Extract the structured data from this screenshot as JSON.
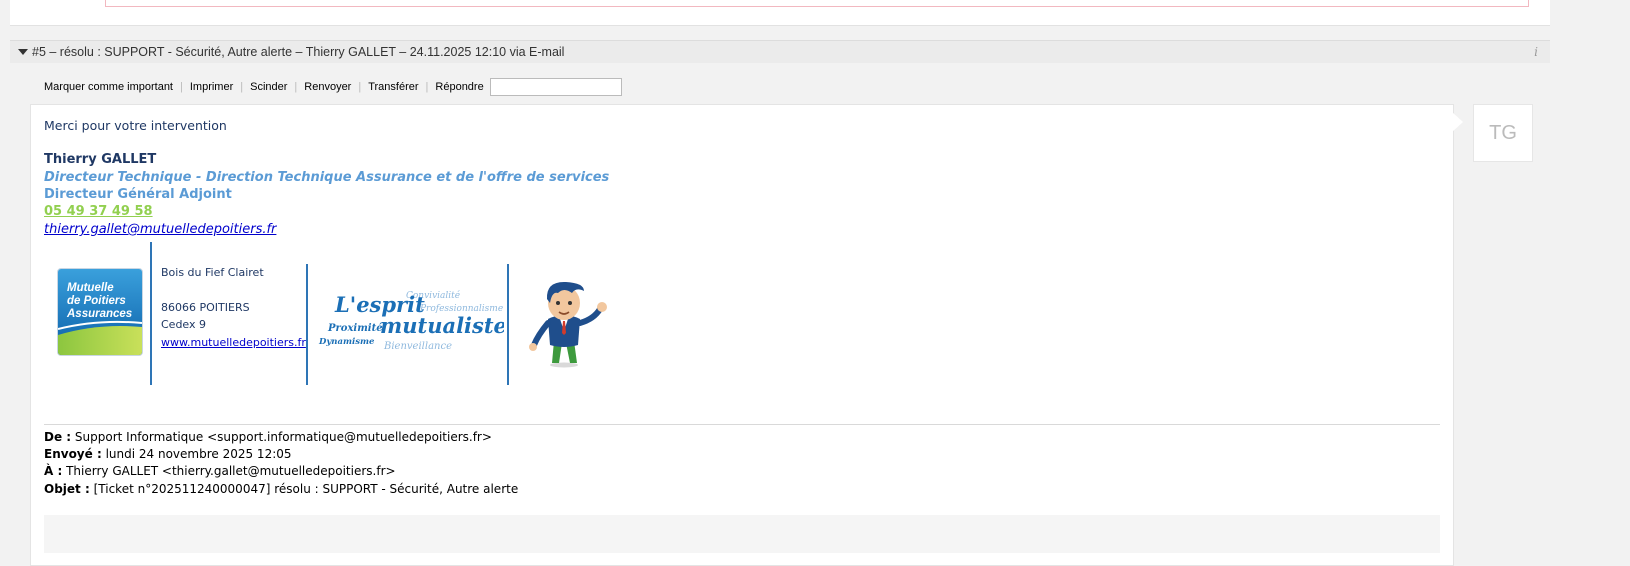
{
  "message": {
    "title": "#5 – résolu : SUPPORT - Sécurité, Autre alerte – Thierry GALLET – 24.11.2025 12:10 via E-mail"
  },
  "toolbar": {
    "important": "Marquer comme important",
    "print": "Imprimer",
    "split": "Scinder",
    "resend": "Renvoyer",
    "forward": "Transférer",
    "reply": "Répondre",
    "reply_value": ""
  },
  "avatar": {
    "initials": "TG"
  },
  "body": {
    "greeting": "Merci pour votre intervention",
    "signature": {
      "name": "Thierry GALLET",
      "role1": "Directeur Technique - Direction Technique Assurance et de l'offre de services",
      "role2": "Directeur Général Adjoint",
      "phone": "05 49 37 49 58",
      "email": "thierry.gallet@mutuelledepoitiers.fr"
    },
    "address": {
      "line1": "Bois du Fief Clairet",
      "line2": "86066 POITIERS",
      "line3": "Cedex 9",
      "website": "www.mutuelledepoitiers.fr"
    },
    "logo_text": [
      "Mutuelle",
      "de Poitiers",
      "Assurances"
    ],
    "slogan": {
      "esprit": "L'esprit",
      "mutualiste": "mutualiste",
      "words": [
        "Convivialité",
        "Professionnalisme",
        "Proximité",
        "Dynamisme",
        "Bienveillance"
      ]
    }
  },
  "quoted_header": {
    "from_label": "De :",
    "from": "Support Informatique <support.informatique@mutuelledepoitiers.fr>",
    "sent_label": "Envoyé :",
    "sent": "lundi 24 novembre 2025 12:05",
    "to_label": "À :",
    "to": "Thierry GALLET <thierry.gallet@mutuelledepoitiers.fr>",
    "subject_label": "Objet :",
    "subject": "[Ticket n°202511240000047] résolu : SUPPORT - Sécurité, Autre alerte"
  },
  "colors": {
    "signature_dark": "#1f3864",
    "signature_blue": "#5b9bd5",
    "phone_green": "#92d050",
    "divider_blue": "#2e75b6"
  }
}
